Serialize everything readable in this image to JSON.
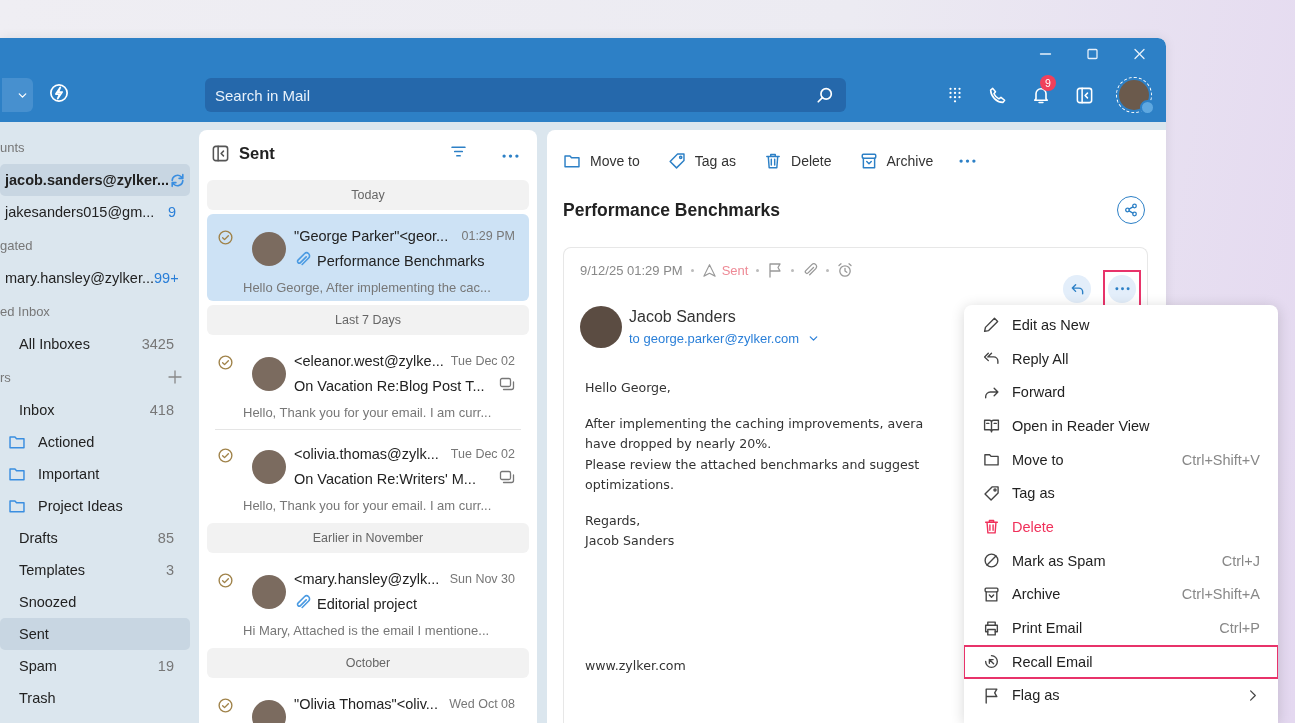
{
  "toolbar": {
    "search": {
      "placeholder": "Search in Mail"
    },
    "notification_count": "9"
  },
  "sidebar": {
    "groups": [
      {
        "heading": "unts",
        "add": false,
        "items": [
          {
            "kind": "account",
            "label": "jacob.sanders@zylker...",
            "selected": true,
            "syncing": true
          },
          {
            "kind": "account",
            "label": "jakesanders015@gm...",
            "count": "9",
            "selected": false,
            "syncing": false
          }
        ]
      },
      {
        "heading": "gated",
        "add": false,
        "items": [
          {
            "kind": "account",
            "label": "mary.hansley@zylker...",
            "count": "99+",
            "selected": false,
            "syncing": false
          }
        ]
      },
      {
        "heading": "ed Inbox",
        "add": false,
        "items": [
          {
            "kind": "folder",
            "label": "All Inboxes",
            "count": "3425",
            "selected": false
          }
        ]
      },
      {
        "heading": "rs",
        "add": true,
        "items": [
          {
            "kind": "folder",
            "label": "Inbox",
            "count": "418",
            "selected": false,
            "children": [
              {
                "label": "Actioned",
                "selected": false
              },
              {
                "label": "Important",
                "selected": false
              },
              {
                "label": "Project Ideas",
                "selected": false
              }
            ]
          },
          {
            "kind": "folder",
            "label": "Drafts",
            "count": "85",
            "selected": false
          },
          {
            "kind": "folder",
            "label": "Templates",
            "count": "3",
            "selected": false
          },
          {
            "kind": "folder",
            "label": "Snoozed",
            "selected": false
          },
          {
            "kind": "folder",
            "label": "Sent",
            "selected": true
          },
          {
            "kind": "folder",
            "label": "Spam",
            "count": "19",
            "selected": false
          },
          {
            "kind": "folder",
            "label": "Trash",
            "selected": false
          }
        ]
      }
    ]
  },
  "mail_list": {
    "title": "Sent",
    "groups": [
      {
        "label": "Today",
        "messages": [
          {
            "sender": "\"George Parker\"<geor...",
            "time": "01:29 PM",
            "subject": "Performance Benchmarks",
            "preview": "Hello George,  After implementing the cac...",
            "attachment": true,
            "thread": false,
            "selected": true
          }
        ]
      },
      {
        "label": "Last 7 Days",
        "messages": [
          {
            "sender": "<eleanor.west@zylke...",
            "time": "Tue Dec 02",
            "subject": "On Vacation Re:Blog Post T...",
            "preview": "Hello, Thank you for your email. I am curr...",
            "attachment": false,
            "thread": true,
            "selected": false
          },
          {
            "sender": "<olivia.thomas@zylk...",
            "time": "Tue Dec 02",
            "subject": "On Vacation Re:Writers' M...",
            "preview": "Hello, Thank you for your email. I am curr...",
            "attachment": false,
            "thread": true,
            "selected": false
          }
        ]
      },
      {
        "label": "Earlier in November",
        "messages": [
          {
            "sender": "<mary.hansley@zylk...",
            "time": "Sun Nov 30",
            "subject": "Editorial project",
            "preview": "Hi Mary, Attached is the email I mentione...",
            "attachment": true,
            "thread": false,
            "selected": false
          }
        ]
      },
      {
        "label": "October",
        "messages": [
          {
            "sender": "\"Olivia Thomas\"<oliv...",
            "time": "Wed Oct 08",
            "selected": false
          }
        ]
      }
    ]
  },
  "reading_pane": {
    "actions": [
      "Move to",
      "Tag as",
      "Delete",
      "Archive"
    ],
    "subject": "Performance Benchmarks",
    "email": {
      "date": "9/12/25 01:29 PM",
      "status": "Sent",
      "more_highlighted": true,
      "sender": "Jacob Sanders",
      "to": "to george.parker@zylker.com",
      "body": [
        [
          "Hello George,"
        ],
        [
          "After implementing the caching improvements, avera",
          "have dropped by nearly 20%.",
          "Please review the attached benchmarks and suggest",
          "optimizations."
        ],
        [
          "Regards,",
          "Jacob Sanders"
        ]
      ],
      "signature": "www.zylker.com"
    }
  },
  "context_menu": {
    "items": [
      {
        "kind": "normal",
        "label": "Edit as New",
        "highlighted": false
      },
      {
        "kind": "normal",
        "label": "Reply All",
        "highlighted": false
      },
      {
        "kind": "normal",
        "label": "Forward",
        "highlighted": false
      },
      {
        "kind": "normal",
        "label": "Open in Reader View",
        "highlighted": false
      },
      {
        "kind": "normal",
        "label": "Move to",
        "shortcut": "Ctrl+Shift+V",
        "highlighted": false
      },
      {
        "kind": "normal",
        "label": "Tag as",
        "highlighted": false
      },
      {
        "kind": "danger",
        "label": "Delete",
        "highlighted": false
      },
      {
        "kind": "normal",
        "label": "Mark as Spam",
        "shortcut": "Ctrl+J",
        "highlighted": false
      },
      {
        "kind": "normal",
        "label": "Archive",
        "shortcut": "Ctrl+Shift+A",
        "highlighted": false
      },
      {
        "kind": "normal",
        "label": "Print Email",
        "shortcut": "Ctrl+P",
        "highlighted": false
      },
      {
        "kind": "normal",
        "label": "Recall Email",
        "highlighted": true
      },
      {
        "kind": "submenu",
        "label": "Flag as",
        "highlighted": false
      }
    ]
  }
}
